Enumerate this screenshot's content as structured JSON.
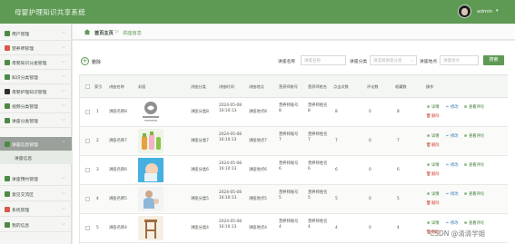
{
  "header": {
    "app_title": "母婴护理知识共享系统",
    "user_name": "admin",
    "user_caret": "▾"
  },
  "sidebar": {
    "items": [
      {
        "label": "用户管理",
        "icon": "user-icon",
        "color": "#4d8a45"
      },
      {
        "label": "营养师管理",
        "icon": "person-card-icon",
        "color": "#d95a4a"
      },
      {
        "label": "母婴知识分类管理",
        "icon": "folder-icon",
        "color": "#4d8a45"
      },
      {
        "label": "知识分类管理",
        "icon": "folder-icon",
        "color": "#4d8a45"
      },
      {
        "label": "母婴护理知识管理",
        "icon": "book-icon",
        "color": "#2f2f2f"
      },
      {
        "label": "视频分类管理",
        "icon": "video-icon",
        "color": "#4d8a45"
      },
      {
        "label": "讲座分类管理",
        "icon": "list-icon",
        "color": "#4d8a45"
      },
      {
        "label": "讲座信息管理",
        "icon": "doc-icon",
        "color": "#4d8a45"
      },
      {
        "label": "讲座预约管理",
        "icon": "calendar-icon",
        "color": "#4d8a45"
      },
      {
        "label": "意见交流区",
        "icon": "chat-icon",
        "color": "#4d8a45"
      },
      {
        "label": "系统管理",
        "icon": "gear-icon",
        "color": "#d95a4a"
      },
      {
        "label": "我的信息",
        "icon": "profile-icon",
        "color": "#4d8a45"
      }
    ],
    "sub_item": "讲座信息"
  },
  "breadcrumb": {
    "first": "首页主页",
    "separator": "▷",
    "second": "讲座信息"
  },
  "toolbar": {
    "add_label": "删除",
    "add_icon": "plus-circle-icon",
    "name_label": "讲座名称",
    "name_placeholder": "讲座名称",
    "category_label": "讲座分类",
    "category_placeholder": "请选择讲座分类",
    "location_label": "讲座地点",
    "location_placeholder": "讲座地点",
    "search_label": "搜索"
  },
  "table": {
    "headers": [
      "索引",
      "讲座名称",
      "封面",
      "讲座分类",
      "讲座时间",
      "讲座地点",
      "营养师账号",
      "营养师姓名",
      "点击次数",
      "评论数",
      "收藏数",
      "操作"
    ],
    "actions": {
      "detail": "详情",
      "edit": "修改",
      "comment": "查看评论",
      "delete": "删除"
    },
    "rows": [
      {
        "index": "1",
        "name": "讲座名称8",
        "category": "讲座分类8",
        "time": "2024-05-08 16:10:13",
        "location": "讲座地点8",
        "account": "营养师账号8",
        "nutritionist": "营养师姓名8",
        "clicks": "8",
        "comments": "0",
        "favorites": "8"
      },
      {
        "index": "2",
        "name": "讲座名称7",
        "category": "讲座分类7",
        "time": "2024-05-08 16:10:13",
        "location": "讲座地点7",
        "account": "营养师账号7",
        "nutritionist": "营养师姓名7",
        "clicks": "7",
        "comments": "0",
        "favorites": "7"
      },
      {
        "index": "3",
        "name": "讲座名称6",
        "category": "讲座分类6",
        "time": "2024-05-08 16:10:13",
        "location": "讲座地点6",
        "account": "营养师账号6",
        "nutritionist": "营养师姓名6",
        "clicks": "6",
        "comments": "0",
        "favorites": "6"
      },
      {
        "index": "4",
        "name": "讲座名称5",
        "category": "讲座分类5",
        "time": "2024-05-08 16:10:13",
        "location": "讲座地点5",
        "account": "营养师账号5",
        "nutritionist": "营养师姓名5",
        "clicks": "5",
        "comments": "0",
        "favorites": "5"
      },
      {
        "index": "5",
        "name": "讲座名称4",
        "category": "讲座分类4",
        "time": "2024-05-08 16:10:13",
        "location": "讲座地点4",
        "account": "营养师账号4",
        "nutritionist": "营养师姓名4",
        "clicks": "4",
        "comments": "0",
        "favorites": "4"
      }
    ]
  },
  "watermark": "CSDN @清清学姐",
  "colors": {
    "accent": "#5e9a54",
    "danger": "#d04a3a",
    "link": "#2f7ab8"
  }
}
